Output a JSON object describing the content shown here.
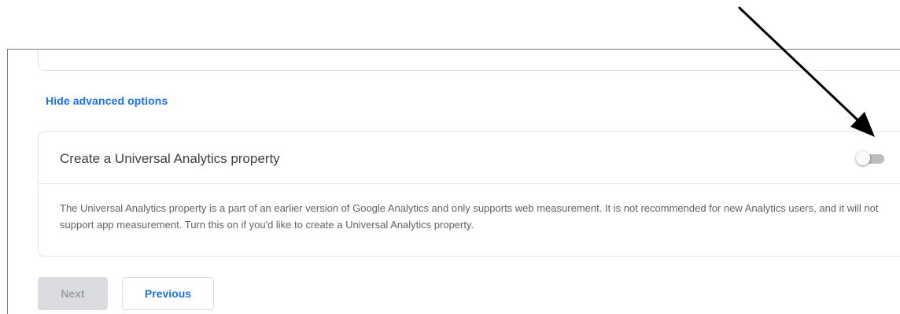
{
  "advanced": {
    "link_label": "Hide advanced options"
  },
  "ua_property": {
    "title": "Create a Universal Analytics property",
    "toggle_state": "off",
    "description": "The Universal Analytics property is a part of an earlier version of Google Analytics and only supports web measurement. It is not recommended for new Analytics users, and it will not support app measurement. Turn this on if you'd like to create a Universal Analytics property."
  },
  "buttons": {
    "next_label": "Next",
    "next_enabled": false,
    "previous_label": "Previous"
  },
  "annotation": {
    "arrow_target": "toggle-switch",
    "arrow_color": "#000000"
  },
  "colors": {
    "link": "#1a73e8",
    "text": "#3c4043",
    "muted_text": "#5f6368",
    "disabled_button_bg": "#dadce0"
  }
}
